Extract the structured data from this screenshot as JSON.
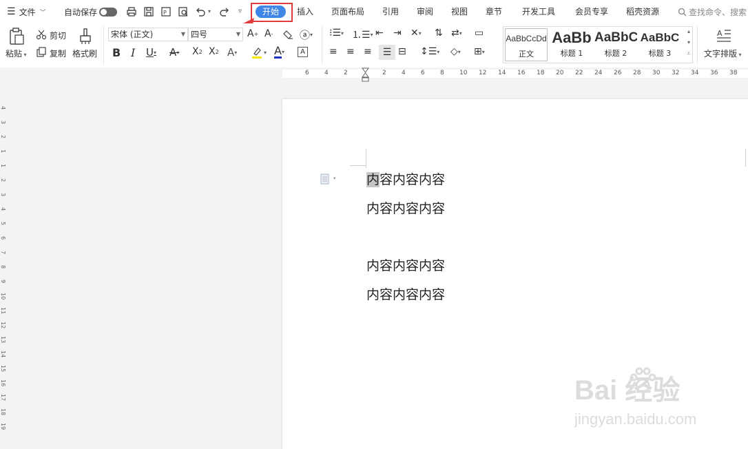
{
  "menu": {
    "file_label": "文件",
    "autosave_label": "自动保存",
    "tabs": [
      "开始",
      "插入",
      "页面布局",
      "引用",
      "审阅",
      "视图",
      "章节",
      "开发工具",
      "会员专享",
      "稻壳资源"
    ],
    "search_placeholder": "查找命令、搜索",
    "active_tab_color": "#3f86e6",
    "highlight_color": "#e03b3b"
  },
  "toolbar": {
    "paste_label": "粘贴",
    "cut_label": "剪切",
    "copy_label": "复制",
    "format_painter_label": "格式刷",
    "font_name": "宋体 (正文)",
    "font_size": "四号",
    "bold": "B",
    "italic": "I",
    "underline": "U",
    "text_layout_label": "文字排版",
    "styles": [
      {
        "sample": "AaBbCcDd",
        "name": "正文"
      },
      {
        "sample": "AaBb",
        "name": "标题 1"
      },
      {
        "sample": "AaBbC",
        "name": "标题 2"
      },
      {
        "sample": "AaBbC",
        "name": "标题 3"
      }
    ]
  },
  "ruler": {
    "numbers": [
      "6",
      "4",
      "2",
      "2",
      "4",
      "6",
      "8",
      "10",
      "12",
      "14",
      "16",
      "18",
      "20",
      "22",
      "24",
      "26",
      "28",
      "30",
      "32",
      "34",
      "36",
      "38"
    ],
    "vertical_numbers": [
      "4",
      "3",
      "2",
      "1",
      "1",
      "2",
      "3",
      "4",
      "5",
      "6",
      "7",
      "8",
      "9",
      "10",
      "11",
      "12",
      "13",
      "14",
      "15",
      "16",
      "17",
      "18",
      "19"
    ]
  },
  "document": {
    "paragraphs": [
      "内容内容内容",
      "内容内容内容",
      "",
      "内容内容内容",
      "内容内容内容"
    ],
    "first_char": "内",
    "first_rest": "容内容内容"
  },
  "watermark": {
    "brand": "Bai 经验",
    "url": "jingyan.baidu.com"
  }
}
